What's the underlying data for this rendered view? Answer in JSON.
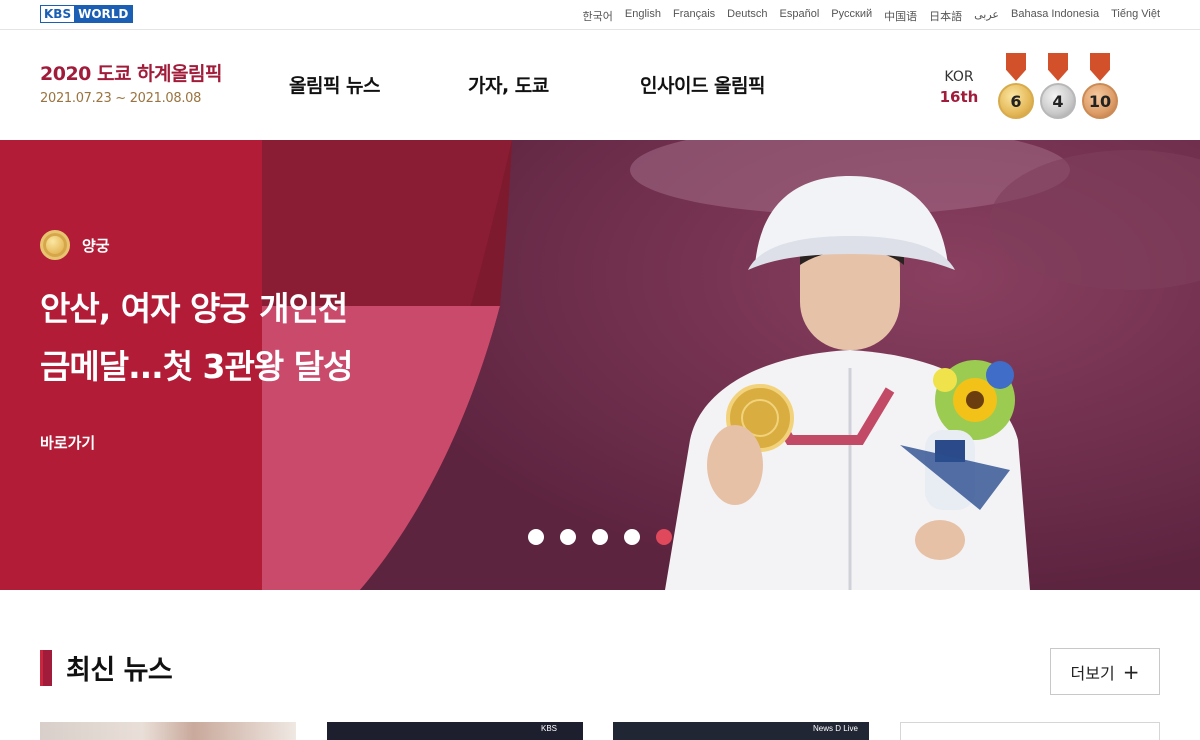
{
  "top_bar": {
    "logo": {
      "kbs": "KBS",
      "world": "WORLD"
    },
    "languages": [
      "한국어",
      "English",
      "Français",
      "Deutsch",
      "Español",
      "Русский",
      "中国语",
      "日本語",
      "عربى",
      "Bahasa Indonesia",
      "Tiếng Việt"
    ]
  },
  "header": {
    "event_title": "2020 도쿄 하계올림픽",
    "event_dates": "2021.07.23 ~ 2021.08.08",
    "nav": [
      "올림픽 뉴스",
      "가자, 도쿄",
      "인사이드 올림픽"
    ],
    "country": {
      "code": "KOR",
      "rank": "16th"
    },
    "medals": {
      "gold": 6,
      "silver": 4,
      "bronze": 10
    }
  },
  "hero": {
    "sport": "양궁",
    "title_lines": [
      "안산, 여자 양궁 개인전",
      "금메달...첫 3관왕 달성"
    ],
    "link": "바로가기",
    "slide_count": 5,
    "active_slide": 5
  },
  "latest_news": {
    "title": "최신 뉴스",
    "more": "더보기",
    "thumb_captions": [
      "KBS",
      "News D Live"
    ]
  },
  "colors": {
    "brand": "#a01c3a",
    "hero_bg": "#b21c36",
    "accent_dot": "#e0485c",
    "link_blue": "#1a5fb4"
  }
}
